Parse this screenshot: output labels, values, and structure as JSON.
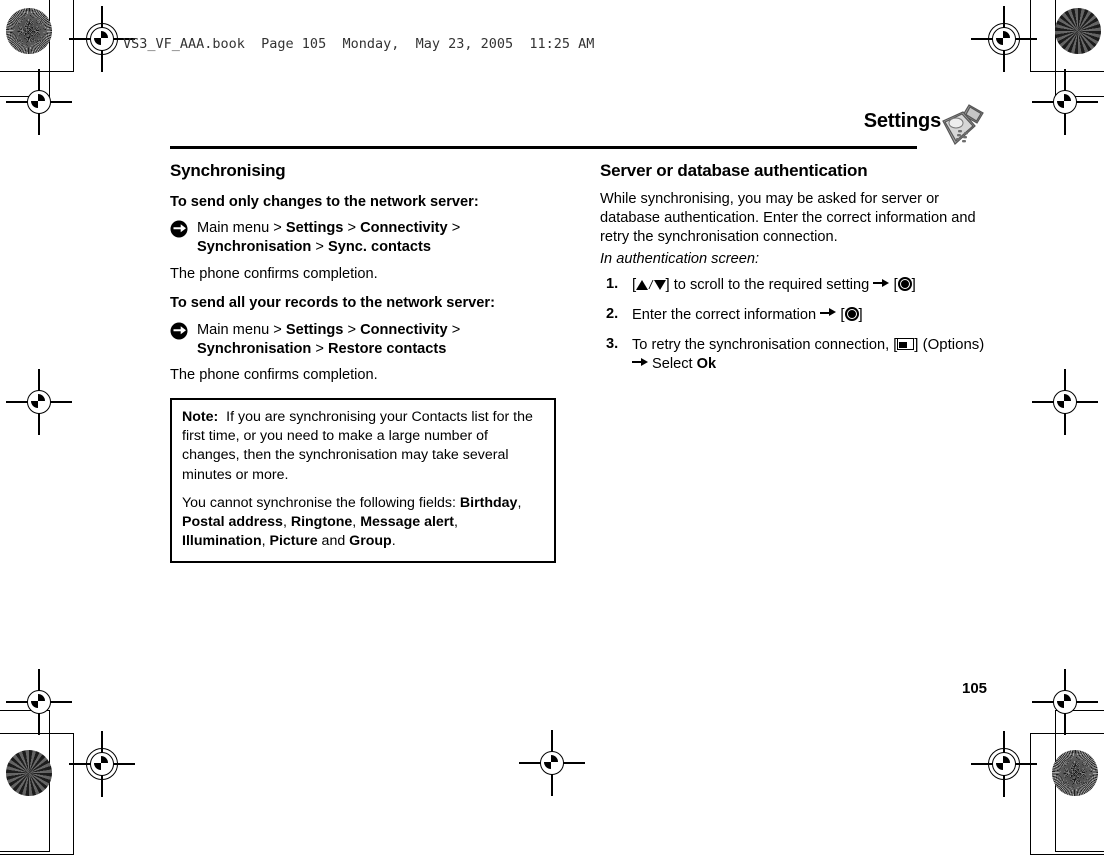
{
  "print_header": "VS3_VF_AAA.book  Page 105  Monday,  May 23, 2005  11:25 AM",
  "running_head": {
    "title": "Settings",
    "icon": "mobile-phone-icon"
  },
  "page_number": "105",
  "left_column": {
    "section_title": "Synchronising",
    "sub1": "To send only changes to the network server:",
    "path1_line1_pre": "Main menu",
    "path1_line1": [
      {
        "t": " > ",
        "b": false
      },
      {
        "t": "Settings",
        "b": true
      },
      {
        "t": " > ",
        "b": false
      },
      {
        "t": "Connectivity",
        "b": true
      },
      {
        "t": " > ",
        "b": false
      }
    ],
    "path1_line2": [
      {
        "t": "Synchronisation",
        "b": true
      },
      {
        "t": " > ",
        "b": false
      },
      {
        "t": "Sync. contacts",
        "b": true
      }
    ],
    "confirm1": "The phone confirms completion.",
    "sub2": "To send all your records to the network server:",
    "path2_line1_pre": "Main menu",
    "path2_line1": [
      {
        "t": " > ",
        "b": false
      },
      {
        "t": "Settings",
        "b": true
      },
      {
        "t": " > ",
        "b": false
      },
      {
        "t": "Connectivity",
        "b": true
      },
      {
        "t": " > ",
        "b": false
      }
    ],
    "path2_line2": [
      {
        "t": "Synchronisation",
        "b": true
      },
      {
        "t": " > ",
        "b": false
      },
      {
        "t": "Restore contacts",
        "b": true
      }
    ],
    "confirm2": "The phone confirms completion."
  },
  "note_box": {
    "label": "Note:",
    "para1": "If you are synchronising your Contacts list for the first time, or you need to make a large number of changes, then the synchronisation may take several minutes or more.",
    "para2_parts": [
      {
        "t": "You cannot synchronise the following fields: ",
        "b": false
      },
      {
        "t": "Birthday",
        "b": true
      },
      {
        "t": ", ",
        "b": false
      },
      {
        "t": "Postal address",
        "b": true
      },
      {
        "t": ", ",
        "b": false
      },
      {
        "t": "Ringtone",
        "b": true
      },
      {
        "t": ", ",
        "b": false
      },
      {
        "t": "Message alert",
        "b": true
      },
      {
        "t": ", ",
        "b": false
      },
      {
        "t": "Illumination",
        "b": true
      },
      {
        "t": ", ",
        "b": false
      },
      {
        "t": "Picture",
        "b": true
      },
      {
        "t": " and ",
        "b": false
      },
      {
        "t": "Group",
        "b": true
      },
      {
        "t": ".",
        "b": false
      }
    ]
  },
  "right_column": {
    "section_title": "Server or database authentication",
    "intro": "While synchronising, you may be asked for server or database authentication. Enter the correct information and retry the synchronisation connection.",
    "context_line": "In authentication screen:",
    "steps": [
      {
        "num": "1.",
        "parts": [
          {
            "t": "[",
            "k": "bracket"
          },
          {
            "t": "",
            "k": "triangle-up-icon"
          },
          {
            "t": "/",
            "k": "slash"
          },
          {
            "t": "",
            "k": "triangle-down-icon"
          },
          {
            "t": "]",
            "k": "bracket"
          },
          {
            "t": " to scroll to the required setting ",
            "k": "text"
          },
          {
            "t": "",
            "k": "arrow-right-icon"
          },
          {
            "t": " [",
            "k": "bracket"
          },
          {
            "t": "",
            "k": "center-key-icon"
          },
          {
            "t": "]",
            "k": "bracket"
          }
        ]
      },
      {
        "num": "2.",
        "parts": [
          {
            "t": "Enter the correct information ",
            "k": "text"
          },
          {
            "t": "",
            "k": "arrow-right-icon"
          },
          {
            "t": " [",
            "k": "bracket"
          },
          {
            "t": "",
            "k": "center-key-icon"
          },
          {
            "t": "]",
            "k": "bracket"
          }
        ]
      },
      {
        "num": "3.",
        "parts": [
          {
            "t": "To retry the synchronisation connection, [",
            "k": "text"
          },
          {
            "t": "",
            "k": "soft-key-icon"
          },
          {
            "t": "] (Options) ",
            "k": "bracket"
          },
          {
            "t": "",
            "k": "arrow-right-icon"
          },
          {
            "t": " Select ",
            "k": "text"
          },
          {
            "t": "Ok",
            "k": "bold"
          }
        ]
      }
    ]
  }
}
